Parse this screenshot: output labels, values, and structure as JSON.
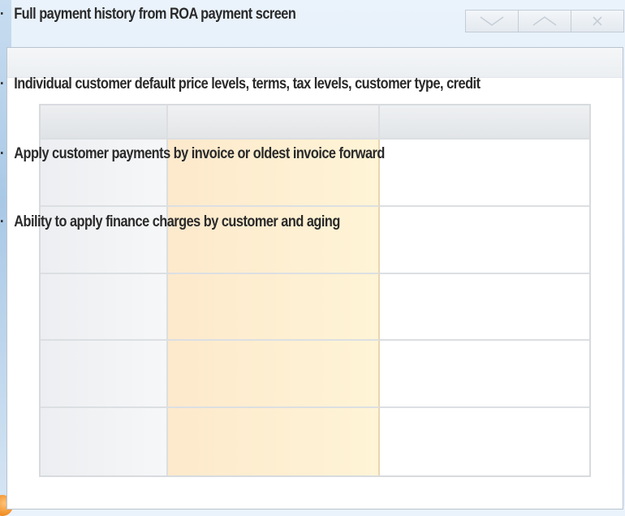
{
  "bullets": [
    "Full payment history from ROA payment screen",
    "Individual customer default price levels, terms, tax levels, customer type, credit",
    "Apply customer payments by invoice or oldest invoice forward",
    "Ability to apply finance charges by customer and aging"
  ],
  "bullet_marker": "·",
  "window": {
    "caption_buttons": [
      "chevron-down-icon",
      "chevron-up-icon",
      "close-icon"
    ]
  },
  "colors": {
    "highlight_column": "#fff0d2",
    "background": "#dbe9f6"
  }
}
